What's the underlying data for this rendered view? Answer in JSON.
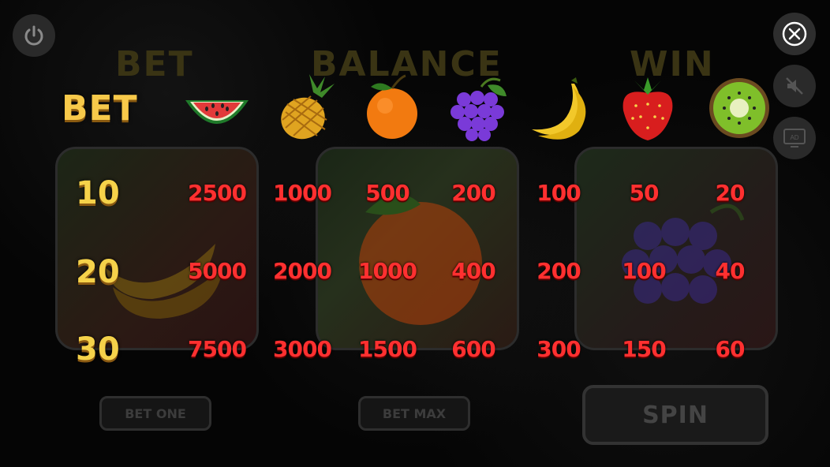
{
  "header": {
    "bet_label": "BET",
    "balance_label": "BALANCE",
    "win_label": "WIN"
  },
  "paytable": {
    "title": "BET",
    "fruits": [
      "watermelon",
      "pineapple",
      "orange",
      "grapes",
      "banana",
      "strawberry",
      "kiwi"
    ],
    "rows": [
      {
        "bet": "10",
        "pays": [
          "2500",
          "1000",
          "500",
          "200",
          "100",
          "50",
          "20"
        ]
      },
      {
        "bet": "20",
        "pays": [
          "5000",
          "2000",
          "1000",
          "400",
          "200",
          "100",
          "40"
        ]
      },
      {
        "bet": "30",
        "pays": [
          "7500",
          "3000",
          "1500",
          "600",
          "300",
          "150",
          "60"
        ]
      }
    ]
  },
  "controls": {
    "bet_one": "BET ONE",
    "bet_max": "BET MAX",
    "spin": "SPIN",
    "ad_label": "AD"
  },
  "icons": {
    "power": "power-icon",
    "close": "close-icon",
    "mute": "sound-off-icon",
    "ad": "ad-icon"
  },
  "colors": {
    "payout_red": "#ff3030",
    "title_gold": "#f7c94a"
  }
}
